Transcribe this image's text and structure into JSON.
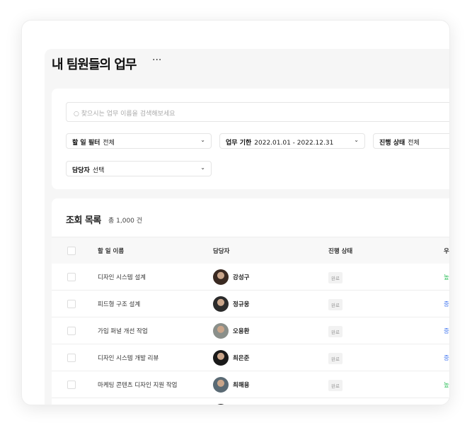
{
  "page": {
    "title": "내 팀원들의 업무",
    "more": "···"
  },
  "search": {
    "placeholder": "찾으시는 업무 이름을 검색해보세요",
    "icon": "search-icon"
  },
  "filters": [
    {
      "label": "할 일 필터",
      "value": "전체"
    },
    {
      "label": "업무 기한",
      "value": "2022.01.01 - 2022.12.31"
    },
    {
      "label": "진행 상태",
      "value": "전체"
    },
    {
      "label": "담당자",
      "value": "선택"
    }
  ],
  "list": {
    "title": "조회 목록",
    "count": "총 1,000 건",
    "columns": [
      "할 일 이름",
      "담당자",
      "진행 상태",
      "우선순위"
    ],
    "rows": [
      {
        "name": "디자인 시스템 설계",
        "assignee": "강성구",
        "status": "완료",
        "priority": "높음"
      },
      {
        "name": "피드형 구조 설계",
        "assignee": "정규웅",
        "status": "완료",
        "priority": "중간"
      },
      {
        "name": "가입 퍼널 개선 작업",
        "assignee": "오용환",
        "status": "완료",
        "priority": "중간"
      },
      {
        "name": "디자인 시스템 개발 리뷰",
        "assignee": "최은준",
        "status": "완료",
        "priority": "중간"
      },
      {
        "name": "마케팅 콘텐츠 디자인 지원 작업",
        "assignee": "최해용",
        "status": "완료",
        "priority": "높음"
      }
    ]
  },
  "colors": {
    "high": "#2fbf5b",
    "medium": "#4a7cf0"
  }
}
